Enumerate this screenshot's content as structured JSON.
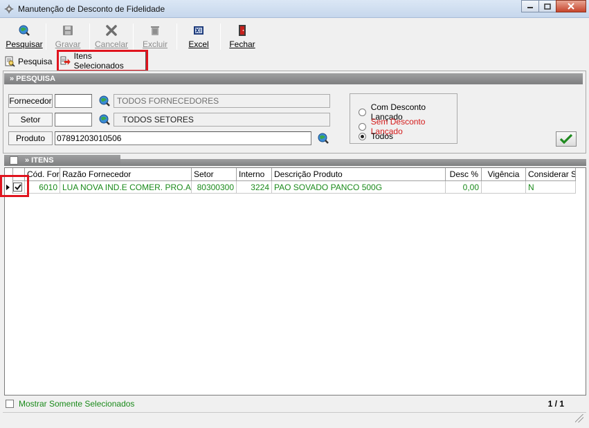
{
  "window": {
    "title": "Manutenção de Desconto de Fidelidade"
  },
  "toolbar": {
    "pesquisar": "Pesquisar",
    "gravar": "Gravar",
    "cancelar": "Cancelar",
    "excluir": "Excluir",
    "excel": "Excel",
    "fechar": "Fechar"
  },
  "tabs": {
    "pesquisa": "Pesquisa",
    "itens_selecionados": "Itens Selecionados"
  },
  "search": {
    "header": "» PESQUISA",
    "fornecedor_label": "Fornecedor",
    "fornecedor_code": "",
    "fornecedor_name": "TODOS FORNECEDORES",
    "setor_label": "Setor",
    "setor_code": "",
    "setor_name": "TODOS SETORES",
    "produto_label": "Produto",
    "produto_value": "07891203010506",
    "options": {
      "com_desconto": "Com Desconto Lançado",
      "sem_desconto": "Sem Desconto Lançado",
      "todos": "Todos"
    },
    "selected_option": "todos"
  },
  "items": {
    "header": "» ITENS",
    "columns": {
      "cod_forn": "Cód. Forn",
      "razao": "Razão Fornecedor",
      "setor": "Setor",
      "interno": "Interno",
      "descricao": "Descrição Produto",
      "desc_pct": "Desc %",
      "vigencia": "Vigência",
      "considerar_st": "Considerar ST"
    },
    "rows": [
      {
        "cod_forn": "6010",
        "razao": "LUA NOVA IND.E COMER. PRO.ALIM.",
        "setor": "80300300",
        "interno": "3224",
        "descricao": "PAO SOVADO PANCO 500G",
        "desc_pct": "0,00",
        "vigencia": "",
        "considerar_st": "N"
      }
    ]
  },
  "footer": {
    "mostrar_label": "Mostrar Somente Selecionados",
    "pager": "1 / 1"
  },
  "colors": {
    "highlight_red": "#e0141e",
    "data_green": "#1a8a1a",
    "sem_desconto_red": "#d41a1a"
  }
}
